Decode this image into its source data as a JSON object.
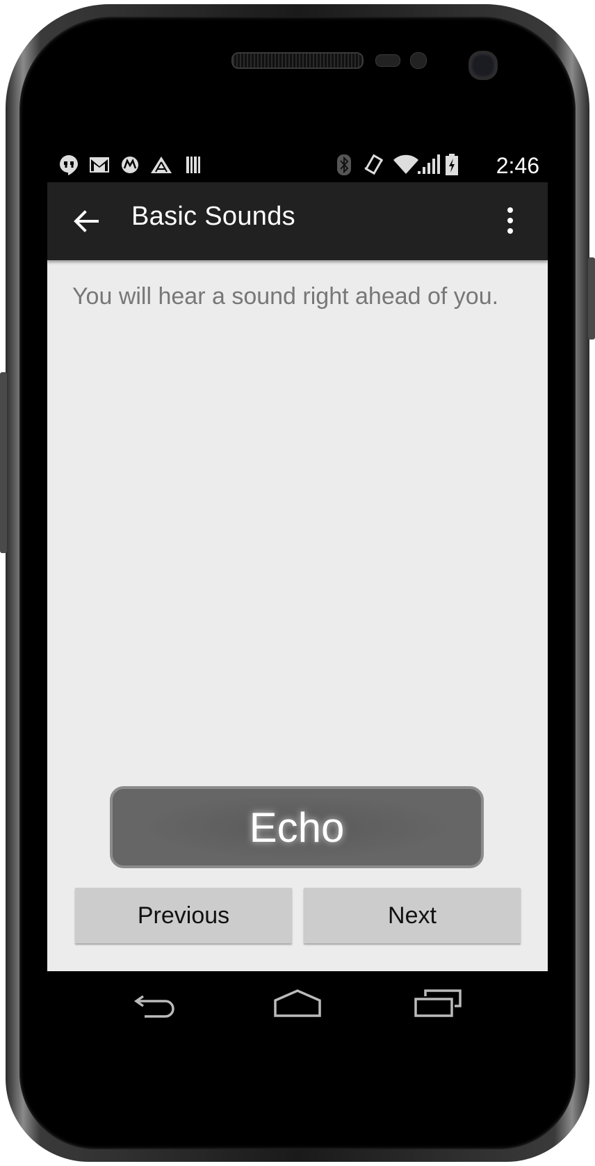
{
  "status_bar": {
    "left_icons": [
      "hangouts-icon",
      "gmail-icon",
      "motorola-icon",
      "assist-icon",
      "barcode-icon"
    ],
    "right_icons": [
      "bluetooth-icon",
      "vibrate-icon",
      "wifi-icon",
      "signal-icon",
      "battery-icon"
    ],
    "time": "2:46"
  },
  "action_bar": {
    "title": "Basic Sounds",
    "back_icon": "arrow-left-icon",
    "menu_icon": "overflow-menu-icon"
  },
  "content": {
    "message": "You will hear a sound right ahead of you.",
    "echo_label": "Echo",
    "previous_label": "Previous",
    "next_label": "Next"
  },
  "nav_bar": {
    "icons": [
      "back-nav-icon",
      "home-nav-icon",
      "recents-nav-icon"
    ]
  },
  "colors": {
    "action_bar_bg": "#212121",
    "screen_bg": "#ececec",
    "echo_bg": "#666666",
    "nav_button_bg": "#cccccc"
  }
}
